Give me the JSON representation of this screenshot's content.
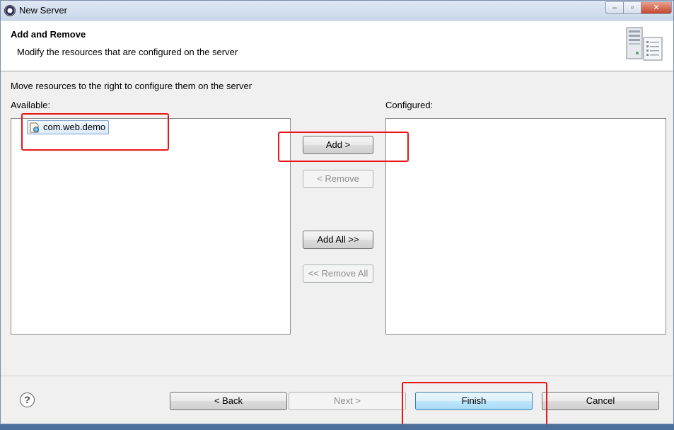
{
  "window": {
    "title": "New Server",
    "controls": {
      "minimize": "–",
      "maximize": "▫",
      "close": "✕"
    }
  },
  "header": {
    "title": "Add and Remove",
    "description": "Modify the resources that are configured on the server",
    "graphic_icon": "server-wizard-icon"
  },
  "main": {
    "instruction": "Move resources to the right to configure them on the server",
    "available": {
      "label": "Available:",
      "items": [
        {
          "label": "com.web.demo",
          "icon": "web-project-icon",
          "selected": true
        }
      ]
    },
    "configured": {
      "label": "Configured:",
      "items": []
    },
    "buttons": {
      "add": "Add >",
      "remove": "< Remove",
      "add_all": "Add All >>",
      "remove_all": "<< Remove All"
    }
  },
  "footer": {
    "help": "?",
    "back": "< Back",
    "next": "Next >",
    "finish": "Finish",
    "cancel": "Cancel"
  },
  "annotations": {
    "color": "#e8161a",
    "count": 3
  }
}
